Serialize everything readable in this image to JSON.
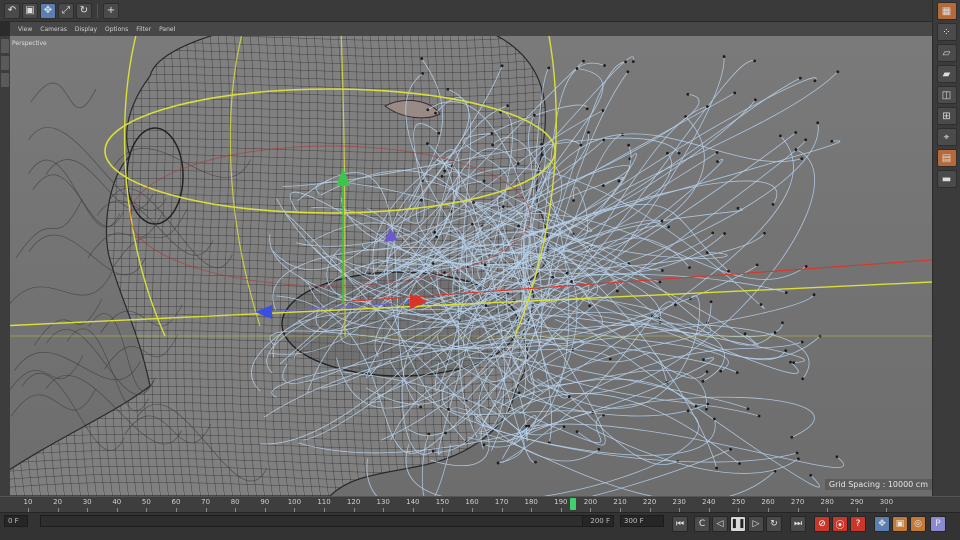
{
  "app": {
    "viewport_label": "Perspective",
    "grid_spacing": "Grid Spacing : 10000 cm"
  },
  "menu": [
    "View",
    "Cameras",
    "Display",
    "Options",
    "Filter",
    "Panel"
  ],
  "timeline": {
    "ticks": [
      "10",
      "20",
      "30",
      "40",
      "50",
      "60",
      "70",
      "80",
      "90",
      "100",
      "110",
      "120",
      "130",
      "140",
      "150",
      "160",
      "170",
      "180",
      "190",
      "200",
      "210",
      "220",
      "230",
      "240",
      "250",
      "260",
      "270",
      "280",
      "290",
      "300"
    ],
    "current_frame": "200"
  },
  "controls": {
    "start_field": "0 F",
    "current_field": "200 F",
    "end_field": "300 F",
    "transport": [
      "go-start",
      "step-back",
      "play-back",
      "pause",
      "play-forward",
      "loop",
      "go-end"
    ],
    "transport_glyphs": [
      "⏮",
      "C",
      "◁",
      "❚❚",
      "▷",
      "↻",
      "⏭"
    ]
  },
  "colors": {
    "wire": "#2a2a2a",
    "hair": "#b9d3f0",
    "guide_yellow": "#d9de3a",
    "axis_red": "#d8352a",
    "axis_green": "#39c64a",
    "axis_blue": "#3a4fe0",
    "playhead": "#3fd16a"
  }
}
